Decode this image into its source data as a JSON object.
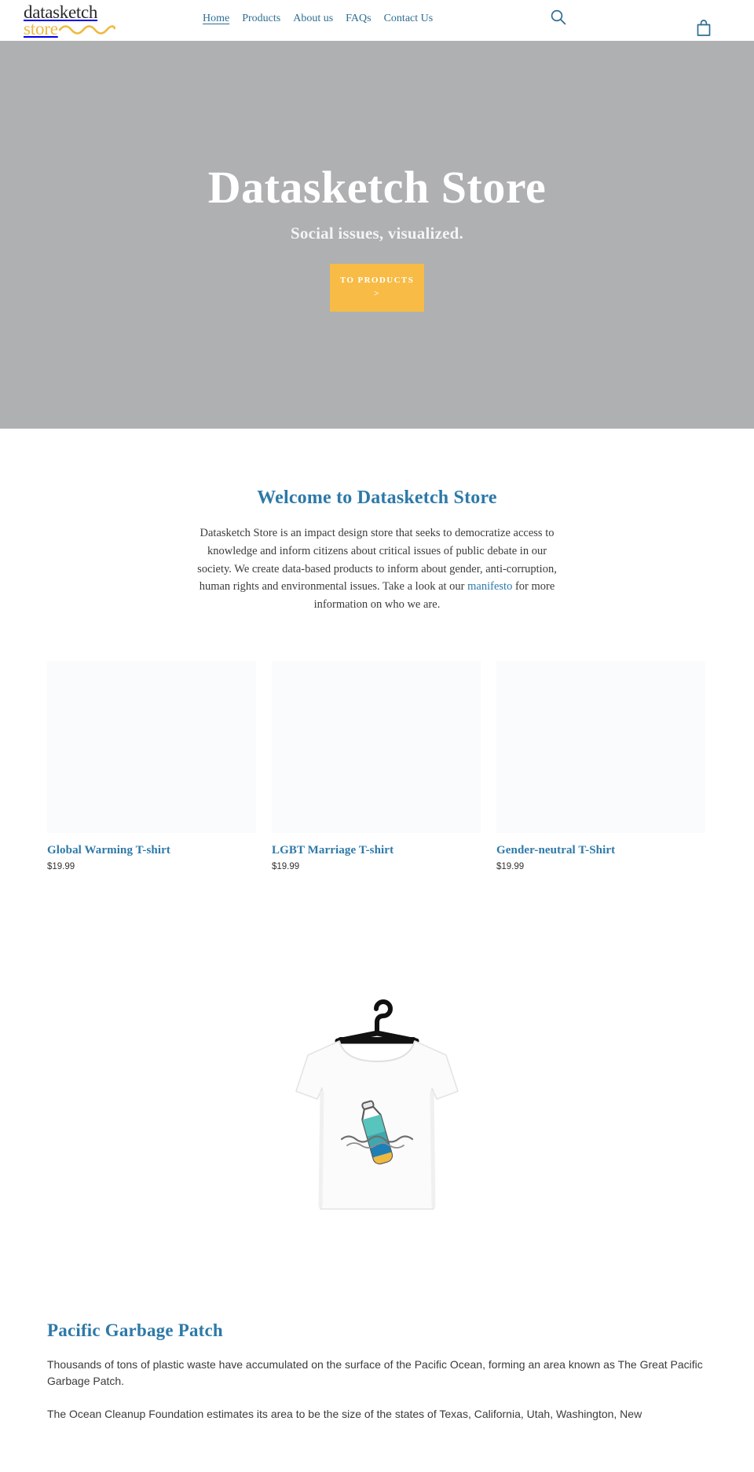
{
  "header": {
    "logo": {
      "line1": "datasketch",
      "line2": "store"
    },
    "nav": [
      {
        "label": "Home",
        "active": true
      },
      {
        "label": "Products",
        "active": false
      },
      {
        "label": "About us",
        "active": false
      },
      {
        "label": "FAQs",
        "active": false
      },
      {
        "label": "Contact Us",
        "active": false
      }
    ],
    "search_icon": "search-icon",
    "cart_icon": "shopping-bag-icon"
  },
  "hero": {
    "title": "Datasketch Store",
    "subtitle": "Social issues, visualized.",
    "cta_label": "TO PRODUCTS",
    "cta_chevron": ">",
    "background_color": "#aeb0b2"
  },
  "welcome": {
    "title": "Welcome to Datasketch Store",
    "text_before_link": "Datasketch Store is an impact design store that seeks to democratize access to knowledge and inform citizens about critical issues of public debate in our society. We create data-based products to inform about gender, anti-corruption, human rights and environmental issues. Take a look at our ",
    "link_label": "manifesto",
    "text_after_link": " for more information on who we are."
  },
  "products": [
    {
      "title": "Global Warming T-shirt",
      "price": "$19.99"
    },
    {
      "title": "LGBT Marriage T-shirt",
      "price": "$19.99"
    },
    {
      "title": "Gender-neutral T-Shirt",
      "price": "$19.99"
    }
  ],
  "feature": {
    "image_alt": "white-tshirt-plastic-bottle-on-hanger",
    "title": "Pacific Garbage Patch",
    "paragraph1": "Thousands of tons of plastic waste have accumulated on the surface of the Pacific Ocean, forming an area known as The Great Pacific Garbage Patch.",
    "paragraph2": "The Ocean Cleanup Foundation estimates its area to be the size of the states of Texas, California, Utah, Washington, New"
  },
  "colors": {
    "brand_blue": "#2d79a8",
    "nav_blue": "#2d6e92",
    "accent_amber": "#f7bb46",
    "logo_gold": "#f0b93f",
    "hero_gray": "#aeb0b2",
    "thumb_placeholder": "#f9fbfd"
  }
}
